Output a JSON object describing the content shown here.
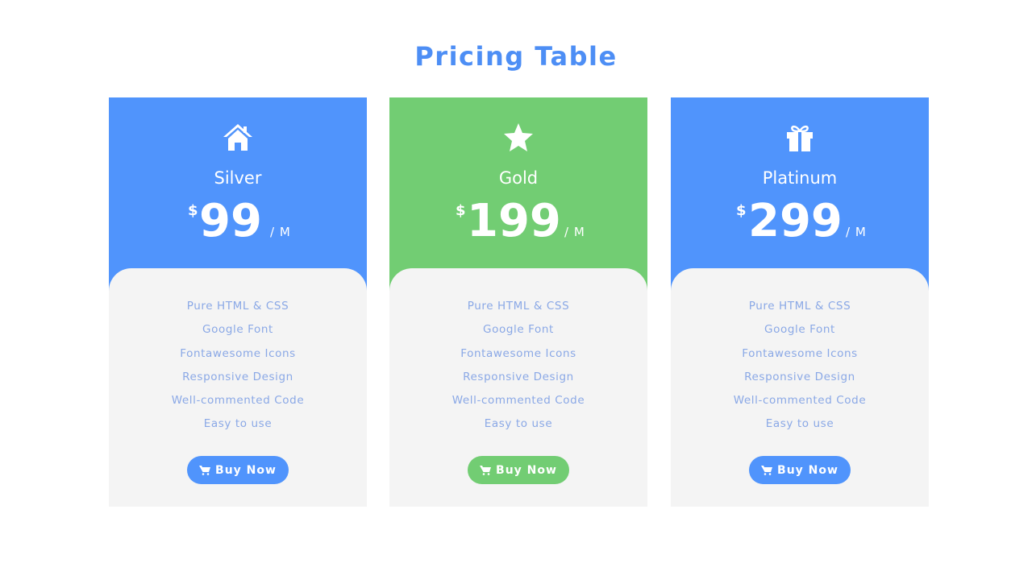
{
  "title": "Pricing Table",
  "colors": {
    "title": "#4d8ef5",
    "blue": "#5094fc",
    "green": "#72cd73",
    "feature_text": "#8aa8e6",
    "card_body": "#f4f4f4"
  },
  "plans": [
    {
      "icon": "home-icon",
      "name": "Silver",
      "currency": "$",
      "price": "99",
      "period": "/ M",
      "accent": "blue",
      "features": [
        "Pure HTML & CSS",
        "Google Font",
        "Fontawesome Icons",
        "Responsive Design",
        "Well-commented Code",
        "Easy to use"
      ],
      "button_label": "Buy Now",
      "button_icon": "cart-icon"
    },
    {
      "icon": "star-icon",
      "name": "Gold",
      "currency": "$",
      "price": "199",
      "period": "/ M",
      "accent": "green",
      "features": [
        "Pure HTML & CSS",
        "Google Font",
        "Fontawesome Icons",
        "Responsive Design",
        "Well-commented Code",
        "Easy to use"
      ],
      "button_label": "Buy Now",
      "button_icon": "cart-icon"
    },
    {
      "icon": "gift-icon",
      "name": "Platinum",
      "currency": "$",
      "price": "299",
      "period": "/ M",
      "accent": "blue",
      "features": [
        "Pure HTML & CSS",
        "Google Font",
        "Fontawesome Icons",
        "Responsive Design",
        "Well-commented Code",
        "Easy to use"
      ],
      "button_label": "Buy Now",
      "button_icon": "cart-icon"
    }
  ]
}
